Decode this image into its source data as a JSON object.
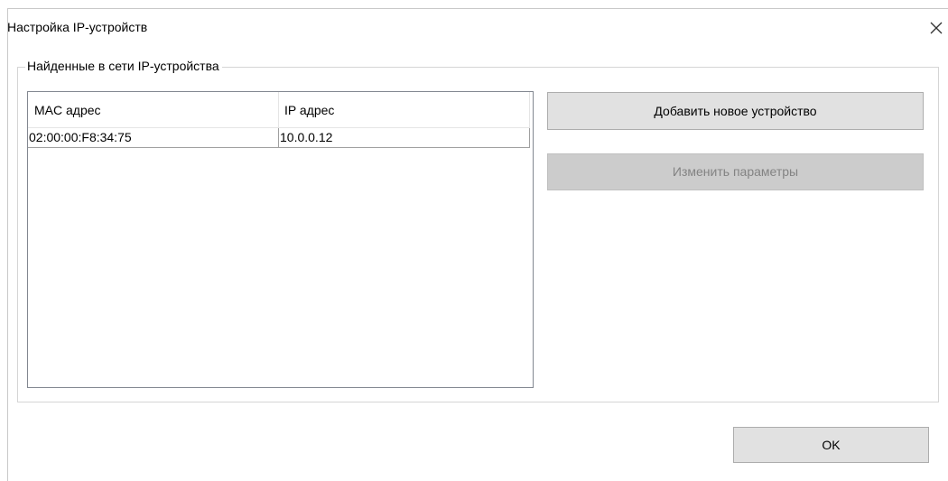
{
  "window": {
    "title": "Настройка IP-устройств",
    "close_glyph": "✕"
  },
  "group": {
    "legend": "Найденные в сети IP-устройства"
  },
  "device_list": {
    "columns": [
      "MAC адрес",
      "IP адрес"
    ],
    "rows": [
      {
        "mac": "02:00:00:F8:34:75",
        "ip": "10.0.0.12"
      }
    ]
  },
  "buttons": {
    "add_device": "Добавить новое устройство",
    "edit_params": "Изменить параметры",
    "ok": "OK"
  },
  "colors": {
    "button_face": "#e1e1e1",
    "button_disabled_face": "#cccccc",
    "disabled_text": "#838383",
    "list_border": "#828790"
  }
}
